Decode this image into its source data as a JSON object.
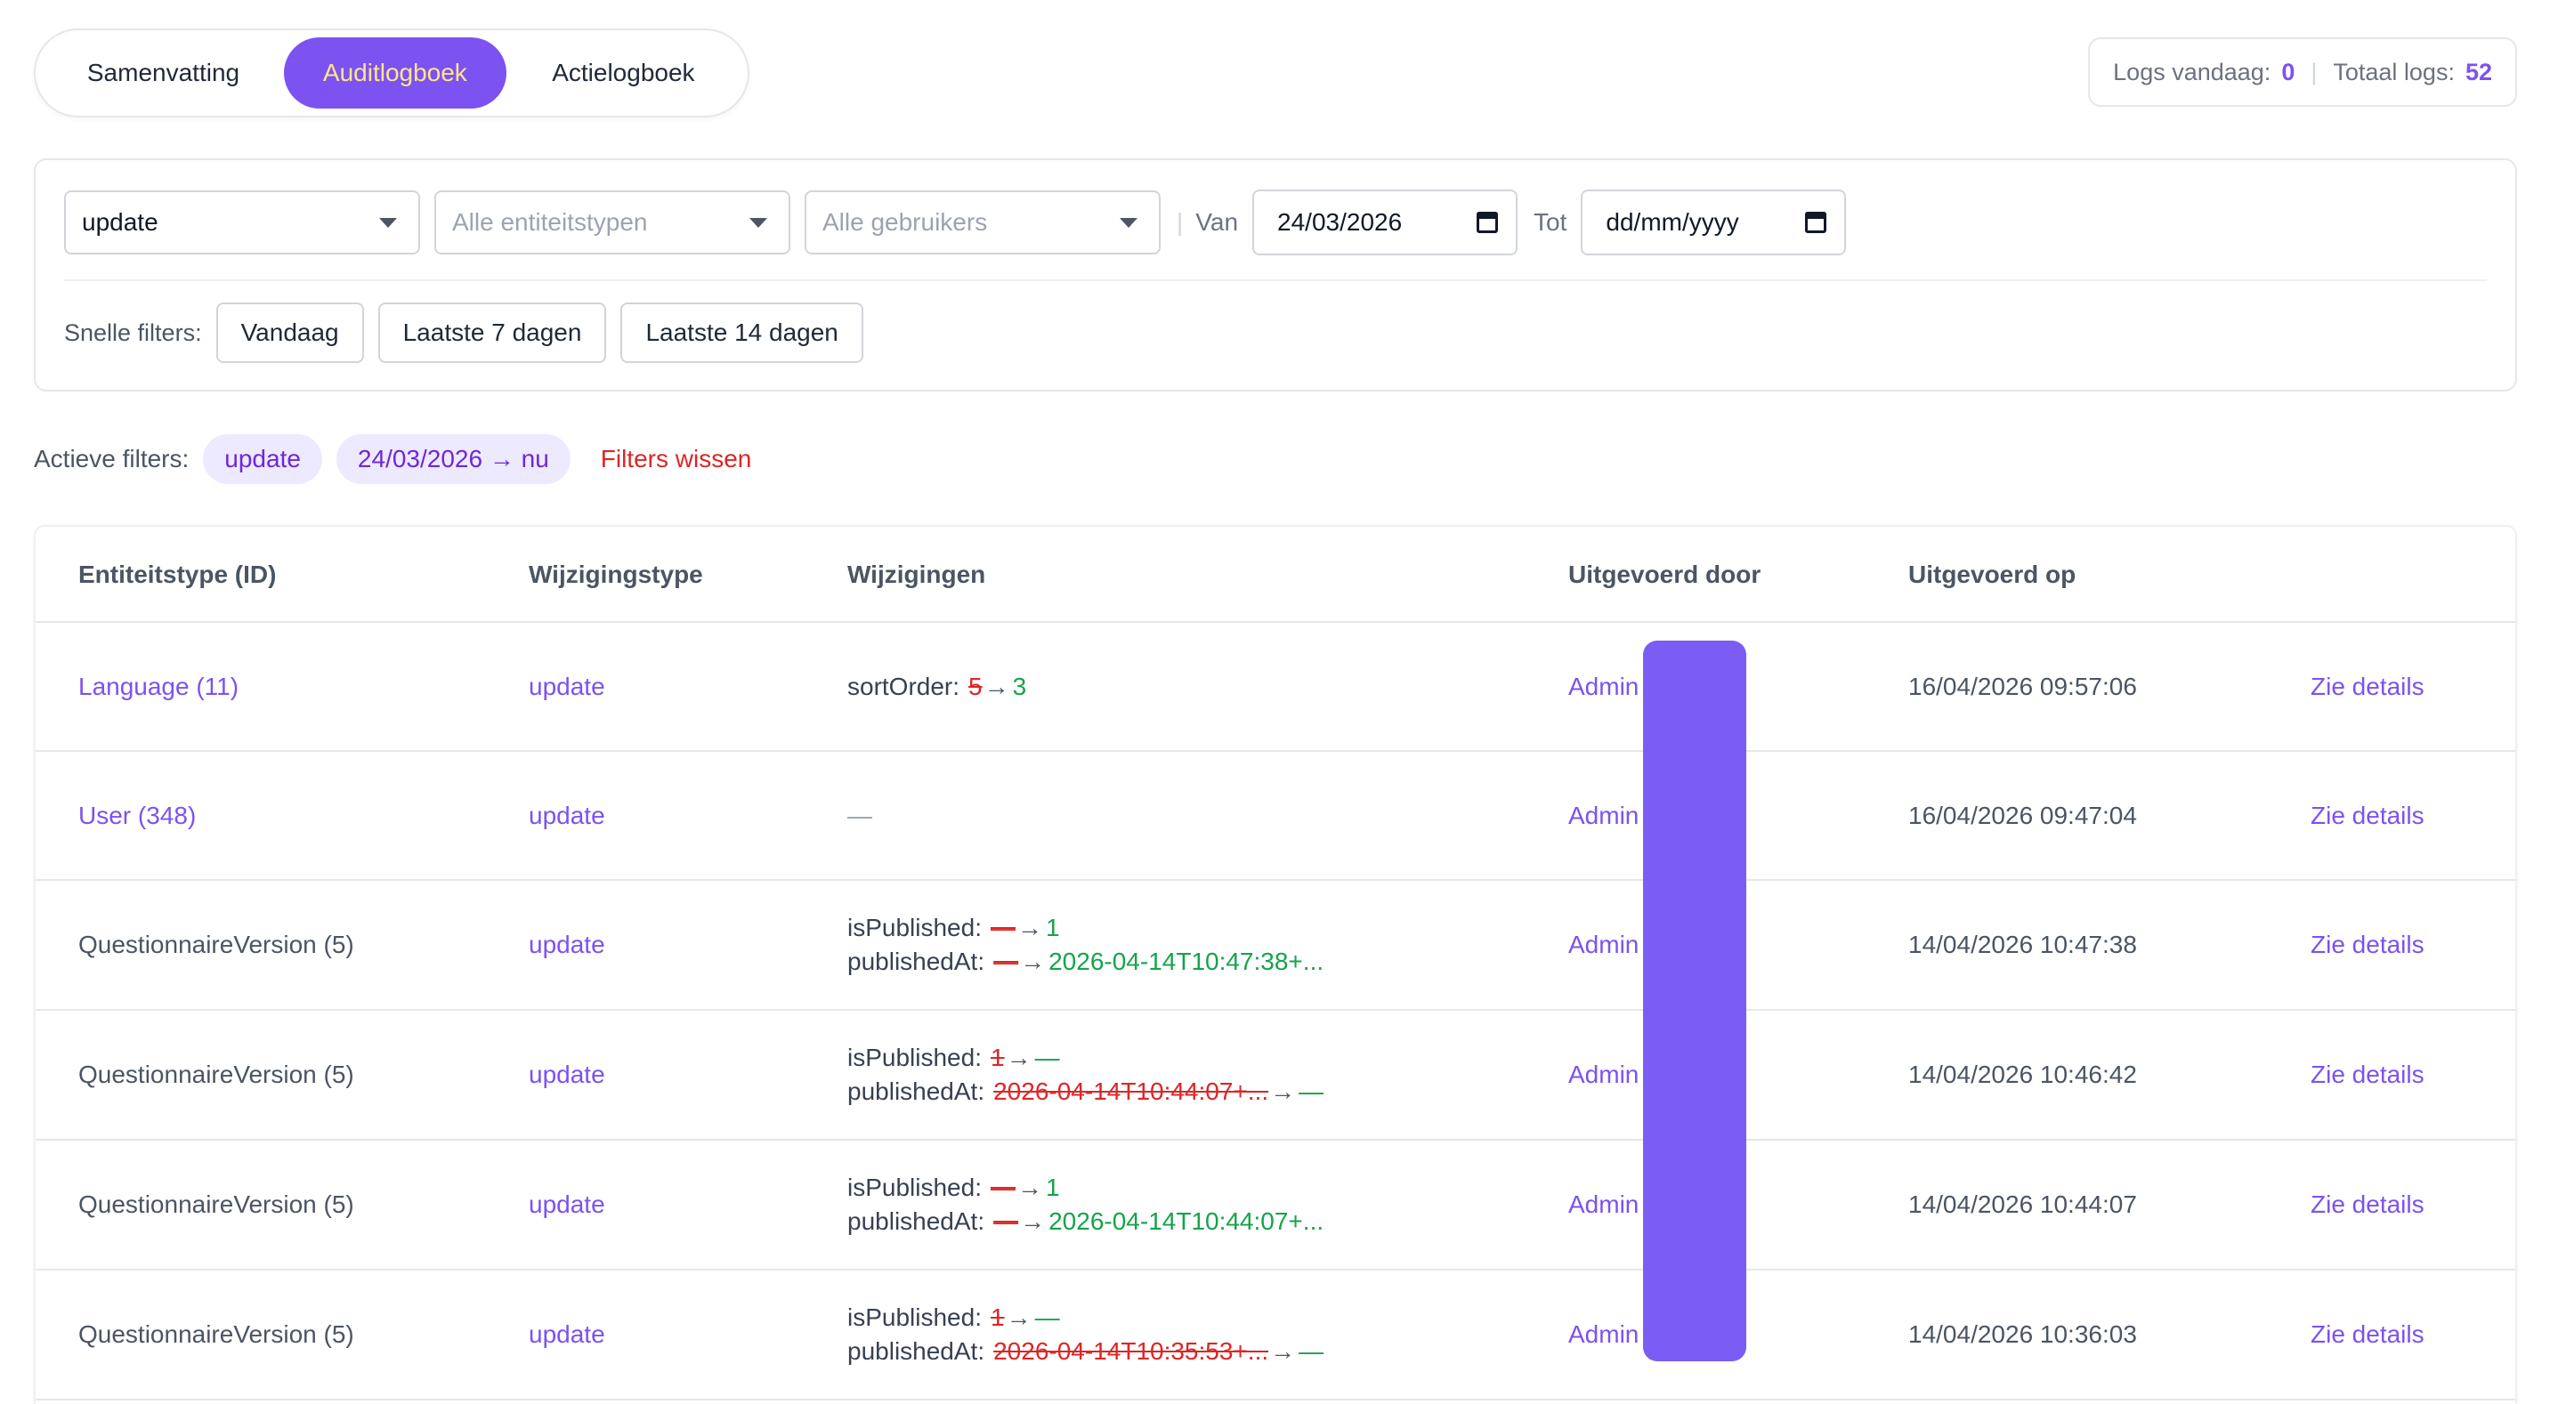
{
  "tabs": [
    {
      "label": "Samenvatting",
      "active": false
    },
    {
      "label": "Auditlogboek",
      "active": true
    },
    {
      "label": "Actielogboek",
      "active": false
    }
  ],
  "stats": {
    "today_label": "Logs vandaag:",
    "today_value": "0",
    "total_label": "Totaal logs:",
    "total_value": "52"
  },
  "filters": {
    "change_type": "update",
    "entity_type_placeholder": "Alle entiteitstypen",
    "user_placeholder": "Alle gebruikers",
    "from_label": "Van",
    "from_value": "24/03/2026",
    "to_label": "Tot",
    "to_value": "dd/mm/yyyy",
    "quick_label": "Snelle filters:",
    "quick": [
      "Vandaag",
      "Laatste 7 dagen",
      "Laatste 14 dagen"
    ]
  },
  "active_filters": {
    "label": "Actieve filters:",
    "chips": [
      "update",
      "24/03/2026 → nu"
    ],
    "clear": "Filters wissen"
  },
  "table": {
    "headers": [
      "Entiteitstype (ID)",
      "Wijzigingstype",
      "Wijzigingen",
      "Uitgevoerd door",
      "Uitgevoerd op"
    ],
    "rows": [
      {
        "entity": "Language (11)",
        "entity_link": true,
        "type": "update",
        "changes": [
          {
            "key": "sortOrder:",
            "old": "5",
            "new": "3"
          }
        ],
        "by": "Admin",
        "at": "16/04/2026 09:57:06",
        "action": "Zie details"
      },
      {
        "entity": "User (348)",
        "entity_link": true,
        "type": "update",
        "changes": [],
        "empty": "—",
        "by": "Admin",
        "at": "16/04/2026 09:47:04",
        "action": "Zie details"
      },
      {
        "entity": "QuestionnaireVersion (5)",
        "entity_link": false,
        "type": "update",
        "changes": [
          {
            "key": "isPublished:",
            "old": "—",
            "new": "1"
          },
          {
            "key": "publishedAt:",
            "old": "—",
            "new": "2026-04-14T10:47:38+..."
          }
        ],
        "by": "Admin",
        "at": "14/04/2026 10:47:38",
        "action": "Zie details"
      },
      {
        "entity": "QuestionnaireVersion (5)",
        "entity_link": false,
        "type": "update",
        "changes": [
          {
            "key": "isPublished:",
            "old": "1",
            "new": "—"
          },
          {
            "key": "publishedAt:",
            "old": "2026-04-14T10:44:07+...",
            "new": "—"
          }
        ],
        "by": "Admin",
        "at": "14/04/2026 10:46:42",
        "action": "Zie details"
      },
      {
        "entity": "QuestionnaireVersion (5)",
        "entity_link": false,
        "type": "update",
        "changes": [
          {
            "key": "isPublished:",
            "old": "—",
            "new": "1"
          },
          {
            "key": "publishedAt:",
            "old": "—",
            "new": "2026-04-14T10:44:07+..."
          }
        ],
        "by": "Admin",
        "at": "14/04/2026 10:44:07",
        "action": "Zie details"
      },
      {
        "entity": "QuestionnaireVersion (5)",
        "entity_link": false,
        "type": "update",
        "changes": [
          {
            "key": "isPublished:",
            "old": "1",
            "new": "—"
          },
          {
            "key": "publishedAt:",
            "old": "2026-04-14T10:35:53+...",
            "new": "—"
          }
        ],
        "by": "Admin",
        "at": "14/04/2026 10:36:03",
        "action": "Zie details"
      }
    ]
  }
}
